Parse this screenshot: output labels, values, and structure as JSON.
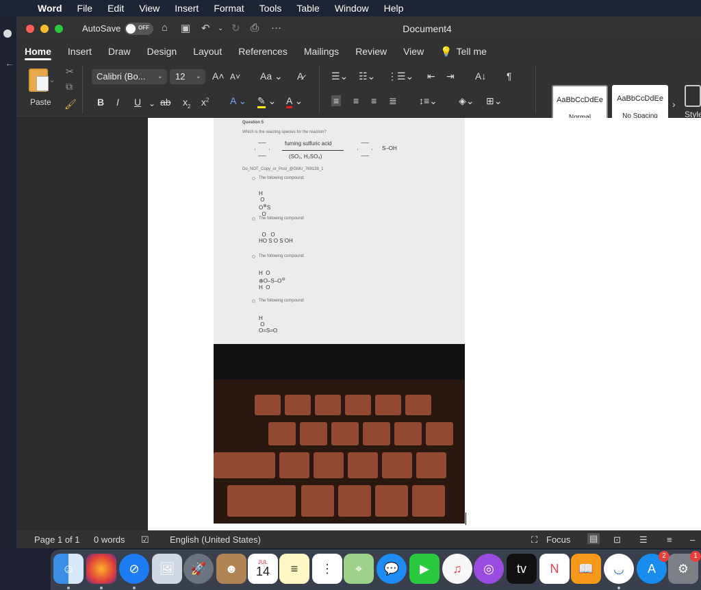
{
  "menubar": {
    "apple": "",
    "items": [
      "Word",
      "File",
      "Edit",
      "View",
      "Insert",
      "Format",
      "Tools",
      "Table",
      "Window",
      "Help"
    ]
  },
  "titlebar": {
    "autosave_label": "AutoSave",
    "autosave_state": "OFF",
    "document_title": "Document4"
  },
  "ribbon_tabs": [
    "Home",
    "Insert",
    "Draw",
    "Design",
    "Layout",
    "References",
    "Mailings",
    "Review",
    "View"
  ],
  "tell_me": "Tell me",
  "ribbon": {
    "paste_label": "Paste",
    "font_name": "Calibri (Bo...",
    "font_size": "12",
    "bold": "B",
    "italic": "I",
    "underline": "U",
    "strike": "ab",
    "subscript": "x",
    "superscript": "x",
    "change_case": "Aa",
    "grow_font": "A",
    "shrink_font": "A",
    "pilcrow": "¶",
    "styles_more": "Style Pane",
    "styles": [
      {
        "sample": "AaBbCcDdEe",
        "name": "Normal"
      },
      {
        "sample": "AaBbCcDdEe",
        "name": "No Spacing"
      }
    ],
    "style_pane_label": "Style Pan"
  },
  "document_photo": {
    "question_title": "Question 5",
    "question_text": "Which is the reacting species for the reaction?",
    "reagent_top": "fuming sulfuric acid",
    "reagent_bottom": "(SO₃, H₂SO₄)",
    "product_label": "S–OH",
    "watermark": "Do_NOT_Copy_or_Post_@GMU_769138_1",
    "options": [
      "The following compound:",
      "The following compound:",
      "The following compound:",
      "The following compound:"
    ],
    "structures": [
      "H–O–S(+)O2",
      "HO–S(=O)–O–S(=O)–OH",
      "H2O(+)–SO3(–)",
      "H–O–S=O"
    ]
  },
  "status": {
    "page": "Page 1 of 1",
    "words": "0 words",
    "language": "English (United States)",
    "focus": "Focus"
  },
  "dock": {
    "calendar_month": "JUL",
    "calendar_day": "14",
    "appstore_badge": "2",
    "settings_badge": "1",
    "tv_label": "tv",
    "apps": [
      "Finder",
      "Firefox",
      "Safari",
      "Preview",
      "Launchpad",
      "Contacts",
      "Calendar",
      "Notes",
      "Reminders",
      "Maps",
      "Messages",
      "FaceTime",
      "Music",
      "Podcasts",
      "TV",
      "News",
      "Books",
      "Word",
      "App Store",
      "System Preferences"
    ]
  },
  "colors": {
    "menubar_bg": "#1d2433",
    "window_bg": "#323232",
    "page_bg": "#ffffff",
    "accent": "#ffffff"
  }
}
